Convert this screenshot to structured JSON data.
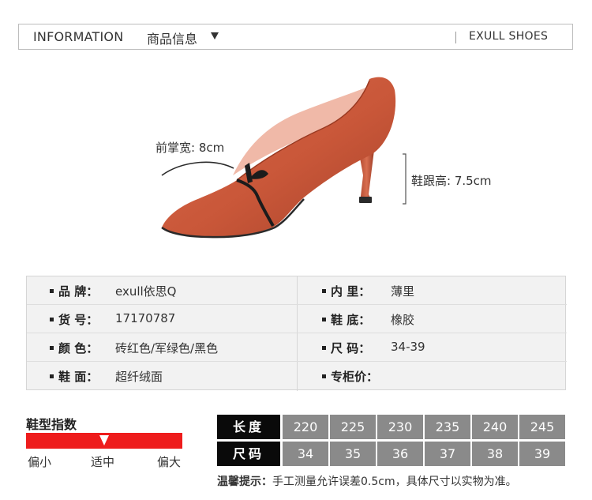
{
  "header": {
    "title_en": "INFORMATION",
    "title_cn": "商品信息",
    "brand": "EXULL SHOES"
  },
  "product": {
    "image_name": "red-suede-pointed-heel-shoe",
    "forefoot_width": "前掌宽: 8cm",
    "heel_height": "鞋跟高: 7.5cm"
  },
  "specs": {
    "rows": [
      {
        "left_label": "品  牌：",
        "left_value": "exull依思Q",
        "right_label": "内  里：",
        "right_value": "薄里"
      },
      {
        "left_label": "货  号：",
        "left_value": "17170787",
        "right_label": "鞋  底：",
        "right_value": "橡胶"
      },
      {
        "left_label": "颜  色：",
        "left_value": "砖红色/军绿色/黑色",
        "right_label": "尺  码：",
        "right_value": "34-39"
      },
      {
        "left_label": "鞋  面：",
        "left_value": "超纤绒面",
        "right_label": "专柜价：",
        "right_value": ""
      }
    ]
  },
  "fit": {
    "title": "鞋型指数",
    "labels": [
      "偏小",
      "适中",
      "偏大"
    ],
    "level": 0.5,
    "bar_color": "#ee1c1c"
  },
  "size_chart": {
    "length_header": "长度",
    "size_header": "尺码",
    "lengths": [
      "220",
      "225",
      "230",
      "235",
      "240",
      "245"
    ],
    "sizes": [
      "34",
      "35",
      "36",
      "37",
      "38",
      "39"
    ],
    "note_label": "温馨提示：",
    "note_text": "手工测量允许误差0.5cm，具体尺寸以实物为准。"
  }
}
